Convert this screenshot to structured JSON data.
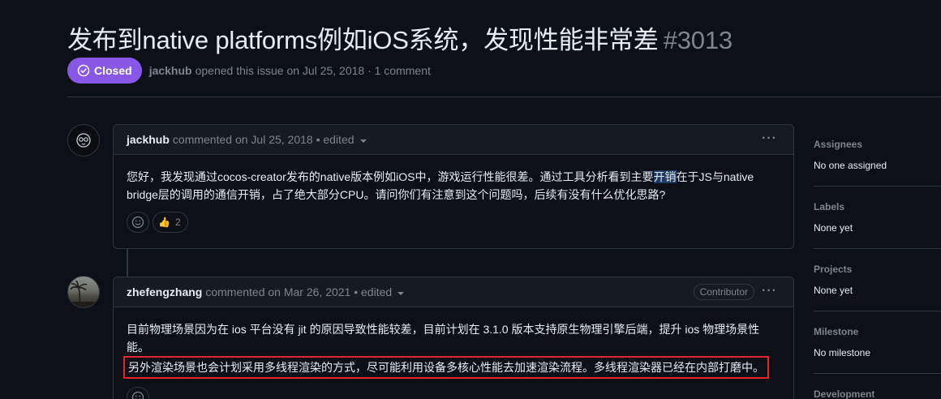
{
  "issue": {
    "title": "发布到native platforms例如iOS系统，发现性能非常差",
    "number": "#3013",
    "status": "Closed",
    "author": "jackhub",
    "opened_text": "opened this issue on Jul 25, 2018 · 1 comment"
  },
  "comments": [
    {
      "author": "jackhub",
      "meta": "commented on Jul 25, 2018 • edited",
      "body_part1": "您好，我发现通过cocos-creator发布的native版本例如iOS中，游戏运行性能很差。通过工具分析看到主要",
      "body_highlight": "开销",
      "body_part2": "在于JS与native bridge层的调用的通信开销，占了绝大部分CPU。请问你们有注意到这个问题吗，后续有没有什么优化思路?",
      "reaction_emoji": "👍",
      "reaction_count": "2"
    },
    {
      "author": "zhefengzhang",
      "meta": "commented on Mar 26, 2021 • edited",
      "badge": "Contributor",
      "body_line1": "目前物理场景因为在 ios 平台没有 jit 的原因导致性能较差，目前计划在 3.1.0 版本支持原生物理引擎后端，提升 ios 物理场景性能。",
      "body_line2": "另外渲染场景也会计划采用多线程渲染的方式，尽可能利用设备多核心性能去加速渲染流程。多线程渲染器已经在内部打磨中。"
    }
  ],
  "sidebar": {
    "assignees_label": "Assignees",
    "assignees_value": "No one assigned",
    "labels_label": "Labels",
    "labels_value": "None yet",
    "projects_label": "Projects",
    "projects_value": "None yet",
    "milestone_label": "Milestone",
    "milestone_value": "No milestone",
    "development_label": "Development"
  },
  "colors": {
    "closed_badge": "#8957e5",
    "highlight_box": "#e5262b",
    "background": "#0d1117"
  }
}
